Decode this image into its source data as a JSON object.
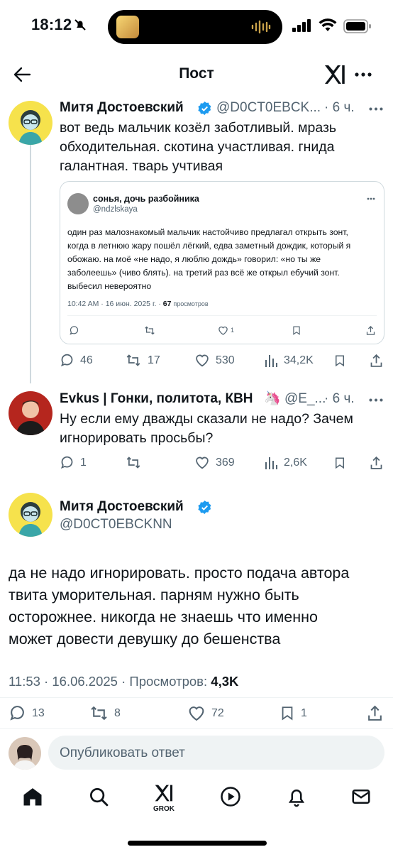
{
  "status": {
    "time": "18:12"
  },
  "header": {
    "title": "Пост"
  },
  "tweet1": {
    "name": "Митя Достоевский",
    "handle": "@D0CT0EBCK...",
    "time": "· 6 ч.",
    "lines": [
      "вот ведь мальчик козёл заботливый. мразь",
      "обходительная. скотина участливая. гнида",
      "галантная. тварь учтивая"
    ],
    "quote": {
      "name": "сонья, дочь разбойника",
      "handle": "@ndzlskaya",
      "lines": [
        "один раз малознакомый мальчик настойчиво предлагал открыть зонт,",
        "когда в летнюю жару пошёл лёгкий, едва заметный дождик, который я",
        "обожаю. на моё «не надо, я люблю дождь» говорил: «но ты же",
        "заболеешь» (чиво блять). на третий раз всё же открыл ебучий зонт.",
        "выбесил невероятно"
      ],
      "meta": "10:42 AM · 16 июн. 2025 г. ·",
      "views": "67",
      "views_label": "просмотров",
      "like_count": "1"
    },
    "replies": "46",
    "reposts": "17",
    "likes": "530",
    "views": "34,2K"
  },
  "tweet2": {
    "name": "Evkus | Гонки, политота, КВН",
    "emoji": "🦄",
    "handle": "@E_...",
    "time": "· 6 ч.",
    "lines": [
      "Ну если ему дважды сказали не надо? Зачем",
      "игнорировать просьбы?"
    ],
    "replies": "1",
    "likes": "369",
    "views": "2,6K"
  },
  "main": {
    "name": "Митя Достоевский",
    "handle": "@D0CT0EBCKNN",
    "lines": [
      "да не надо игнорировать. просто подача автора",
      "твита уморительная. парням нужно быть",
      "осторожнее. никогда не знаешь что именно",
      "может довести девушку до бешенства"
    ],
    "meta": "11:53 · 16.06.2025 · Просмотров:",
    "views": "4,3K",
    "replies": "13",
    "reposts": "8",
    "likes": "72",
    "bookmarks": "1"
  },
  "composer": {
    "placeholder": "Опубликовать ответ"
  },
  "tabbar": {
    "grok_label": "GROK"
  },
  "colors": {
    "accent": "#1d9bf0",
    "muted": "#536471",
    "border": "#cfd9de"
  }
}
